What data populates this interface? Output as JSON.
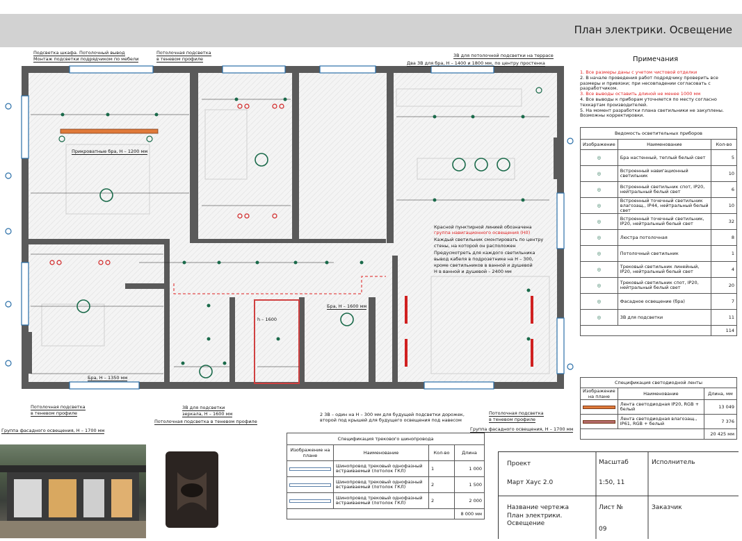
{
  "title": "План электрики. Освещение",
  "notes": {
    "title": "Примечания",
    "items": [
      {
        "text": "1. Все размеры даны с учетом чистовой отделки",
        "red": true
      },
      {
        "text": "2. В начале проведения работ подрядчику проверить все размеры и привязки; при несовпадении согласовать с разработчиком.",
        "red": false
      },
      {
        "text": "3. Все выводы оставить длиной не менее 1000 мм",
        "red": true
      },
      {
        "text": "4. Все выводы к приборам уточняется по месту согласно техкартам производителей.",
        "red": false
      },
      {
        "text": "5. На момент разработки плана светильники не закуплены. Возможны корректировки.",
        "red": false
      }
    ]
  },
  "fixtures": {
    "title": "Ведомость осветительных приборов",
    "headers": [
      "Изображение",
      "Наименование",
      "Кол-во"
    ],
    "rows": [
      {
        "icon": "sconce-icon",
        "name": "Бра настенный, теплый белый свет",
        "qty": "5"
      },
      {
        "icon": "nav-light-icon",
        "name": "Встроенный навигационный светильник",
        "qty": "10"
      },
      {
        "icon": "spot-ip20-icon",
        "name": "Встроенный светильник спот, IP20, нейтральный белый свет",
        "qty": "6"
      },
      {
        "icon": "spot-ip44-icon",
        "name": "Встроенный точечный светильник влагозащ., IP44, нейтральный белый свет",
        "qty": "10"
      },
      {
        "icon": "spot-point-icon",
        "name": "Встроенный точечный светильник, IP20, нейтральный белый свет",
        "qty": "32"
      },
      {
        "icon": "chandelier-icon",
        "name": "Люстра потолочная",
        "qty": "8"
      },
      {
        "icon": "ceiling-light-icon",
        "name": "Потолочный светильник",
        "qty": "1"
      },
      {
        "icon": "track-linear-icon",
        "name": "Трековый светильник линейный, IP20, нейтральный белый свет",
        "qty": "4"
      },
      {
        "icon": "track-spot-icon",
        "name": "Трековый светильник спот, IP20, нейтральный белый свет",
        "qty": "20"
      },
      {
        "icon": "facade-icon",
        "name": "Фасадное освещение (бра)",
        "qty": "7"
      },
      {
        "icon": "socket-3v-icon",
        "name": "3В для подсветки",
        "qty": "11"
      }
    ],
    "total": "114"
  },
  "led": {
    "title": "Спецификация светодиодной ленты",
    "headers": [
      "Изображение на плане",
      "Наименование",
      "Длина, мм"
    ],
    "rows": [
      {
        "name": "Лента светодиодная IP20, RGB + белый",
        "len": "13 049",
        "color": "#e07a3a"
      },
      {
        "name": "Лента светодиодная влагозащ., IP61, RGB + белый",
        "len": "7 376",
        "color": "#b36a6a"
      }
    ],
    "total": "20 425 мм"
  },
  "track": {
    "title": "Спецификация трекового шинопровода",
    "headers": [
      "Изображение на плане",
      "Наименование",
      "Кол-во",
      "Длина"
    ],
    "rows": [
      {
        "name": "Шинопровод трековый однофазный встраиваемый (потолок ГКЛ)",
        "qty": "1",
        "len": "1 000"
      },
      {
        "name": "Шинопровод трековый однофазный встраиваемый (потолок ГКЛ)",
        "qty": "2",
        "len": "1 500"
      },
      {
        "name": "Шинопровод трековый однофазный встраиваемый (потолок ГКЛ)",
        "qty": "2",
        "len": "2 000"
      }
    ],
    "total": "8 000 мм"
  },
  "stamp": {
    "project_label": "Проект",
    "project": "Март Хаус 2.0",
    "scale_label": "Масштаб",
    "scale": "1:50, 11",
    "executor_label": "Исполнитель",
    "drawing_label": "Название чертежа",
    "drawing": "План электрики. Освещение",
    "sheet_label": "Лист №",
    "sheet": "09",
    "client_label": "Заказчик"
  },
  "plan_labels": {
    "cabinet": "Подсветка шкафа. Потолочный вывод",
    "cabinet2": "Монтаж подсветки подрядчиком по мебели",
    "ceil_profile_top": "Потолочная подсветка",
    "ceil_profile_top2": "в теневом профиле",
    "terrace": "3В для потолочной подсветки на террасе",
    "terrace2": "Два 3В для бра, Н – 1400 и 1800 мм, по центру простенка",
    "bedside": "Прикроватные бра, Н – 1200 мм",
    "red_note1": "Красной пунктирной линией обозначена",
    "red_note2": "группа навигационного освещения (Н0)",
    "note3": "Каждый светильник смонтировать по центру",
    "note4": "стены, на которой он расположен",
    "note5": "Предусмотреть для каждого светильника",
    "note6": "вывод кабеля в подрозетнике на Н – 300,",
    "note7": "кроме светильников в ванной и душевой",
    "note8": "Н в ванной и душевой – 2400 мм",
    "bra1350": "Бра, Н – 1350 мм",
    "bra1600": "Бра, Н – 1600 мм",
    "ceil_bl": "Потолочная подсветка",
    "ceil_bl2": "в теневом профиле",
    "mirror": "3В для подсветки",
    "mirror2": "зеркала, Н – 1600 мм",
    "ceil_bottom": "Потолочная подсветка в теневом профиле",
    "facade_left": "Группа фасадного освещения, Н – 1700 мм",
    "facade_right": "Группа фасадного освещения, Н – 1700 мм",
    "two3v": "2 3В – один на Н – 300 мм для будущей подсветки дорожек,",
    "two3v2": "второй под крышей для будущего освещения под навесом",
    "ceil_br": "Потолочная подсветка",
    "ceil_br2": "в теневом профиле",
    "h1600": "h – 1600"
  }
}
